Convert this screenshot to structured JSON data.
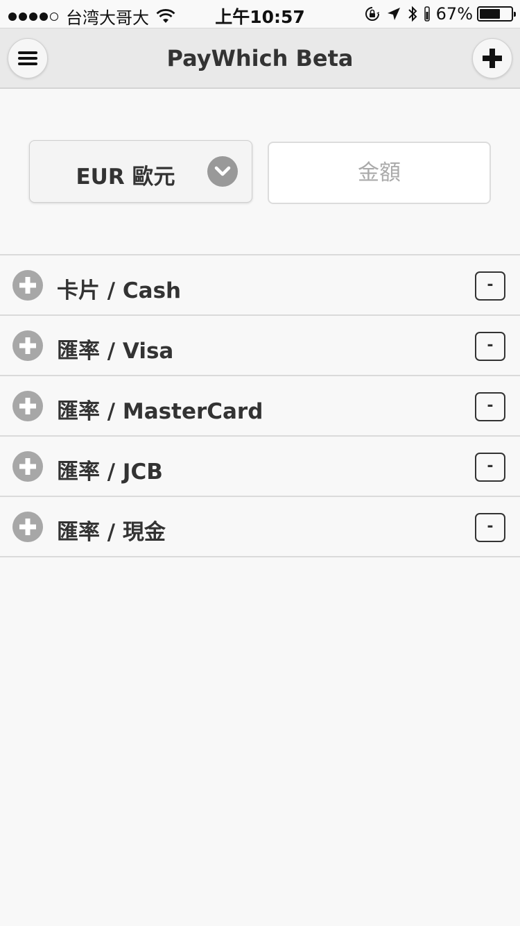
{
  "status_bar": {
    "carrier": "台湾大哥大",
    "time": "上午10:57",
    "battery_percent": "67%",
    "battery_level": 0.67,
    "icons": [
      "signal-dots-icon",
      "wifi-icon",
      "orientation-lock-icon",
      "location-arrow-icon",
      "bluetooth-icon",
      "battery-icon"
    ]
  },
  "header": {
    "title": "PayWhich Beta",
    "menu_icon": "hamburger-menu-icon",
    "add_icon": "plus-icon"
  },
  "currency": {
    "selected": "EUR 歐元",
    "dropdown_icon": "chevron-down-circle-icon"
  },
  "amount": {
    "placeholder": "金額",
    "value": ""
  },
  "rates": [
    {
      "label": "卡片 / Cash",
      "remove_label": "-"
    },
    {
      "label": "匯率 / Visa",
      "remove_label": "-"
    },
    {
      "label": "匯率 / MasterCard",
      "remove_label": "-"
    },
    {
      "label": "匯率 / JCB",
      "remove_label": "-"
    },
    {
      "label": "匯率 / 現金",
      "remove_label": "-"
    }
  ],
  "colors": {
    "background": "#f8f8f8",
    "header_bg": "#e9e9e9",
    "text": "#333333",
    "icon_gray": "#a7a7a7"
  }
}
